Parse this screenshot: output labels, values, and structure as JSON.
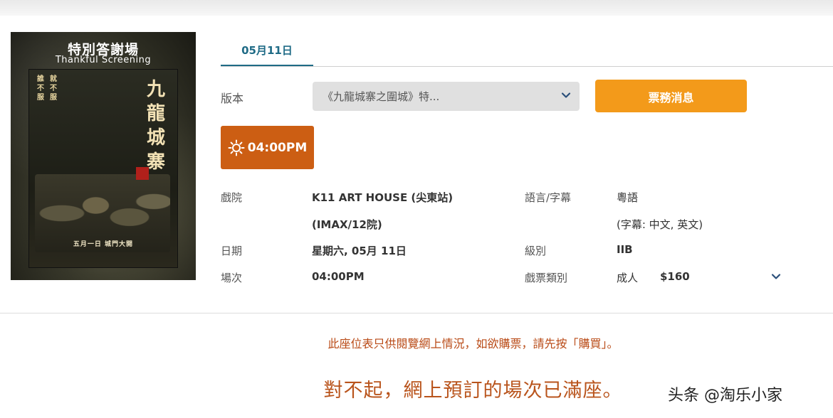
{
  "poster": {
    "title_cn": "特別答謝場",
    "title_en": "Thankful Screening",
    "vertical_title": "九龍城寨",
    "side_text_1": "誰不服",
    "side_text_2": "就不服",
    "release_text": "五月一日 城門大開"
  },
  "date_tab": {
    "label": "05月11日"
  },
  "version": {
    "label": "版本",
    "selected": "《九龍城寨之圍城》特..."
  },
  "ticket_button": {
    "label": "票務消息"
  },
  "showtime_button": {
    "label": "04:00PM",
    "icon": "sun-icon"
  },
  "details": {
    "cinema_label": "戲院",
    "cinema_value_line1": "K11 ART HOUSE (尖東站)",
    "cinema_value_line2": "(IMAX/12院)",
    "date_label": "日期",
    "date_value": "星期六, 05月 11日",
    "session_label": "場次",
    "session_value": "04:00PM",
    "language_label": "語言/字幕",
    "language_value": "粵語",
    "subtitle_value": "(字幕: 中文, 英文)",
    "rating_label": "級別",
    "rating_value": "IIB",
    "ticket_type_label": "戲票類別",
    "ticket_type_value": "成人",
    "ticket_price": "$160"
  },
  "notices": {
    "seating_notice": "此座位表只供閱覽網上情況，如欲購票，請先按「購買」。",
    "sold_out": "對不起，網上預訂的場次已滿座。"
  },
  "watermark": "头条 @淘乐小家",
  "colors": {
    "tab_accent": "#1f6b86",
    "ticket_button": "#f39a1a",
    "showtime_button": "#cc5e13",
    "notice_text": "#b94a16"
  }
}
